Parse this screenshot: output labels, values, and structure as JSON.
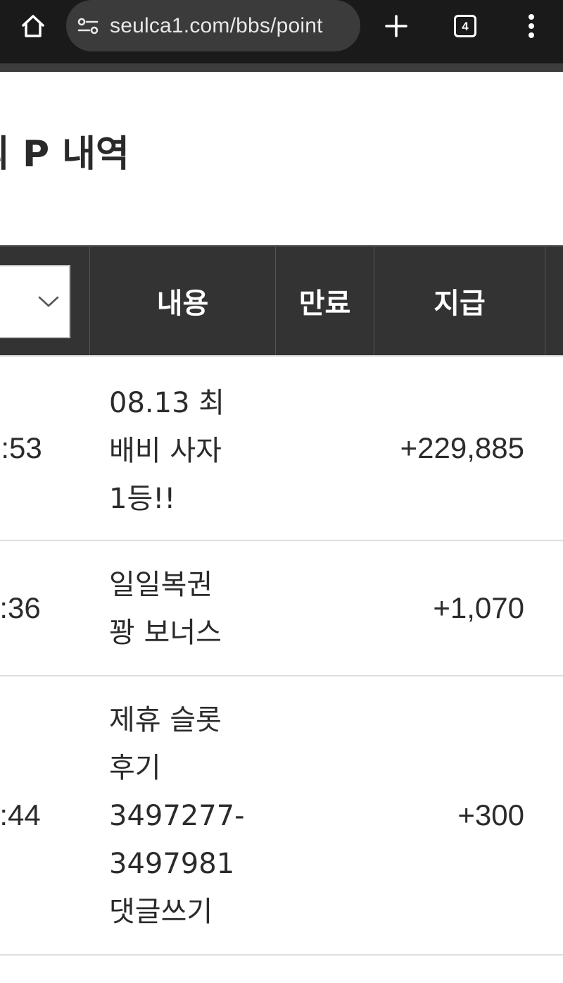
{
  "browser": {
    "url": "seulca1.com/bbs/point",
    "tab_count": "4",
    "icons": {
      "home": "home-icon",
      "site_info": "site-settings-icon",
      "new_tab": "plus-icon",
      "tabs": "tab-switcher-icon",
      "menu": "more-vert-icon"
    }
  },
  "page": {
    "title": "의 P 내역"
  },
  "table": {
    "columns": {
      "content": "내용",
      "expire": "만료",
      "pay": "지급"
    },
    "rows": [
      {
        "time": ":53",
        "content_lines": [
          "08.13 최",
          "배비 사자",
          "1등!!"
        ],
        "pay": "+229,885"
      },
      {
        "time": ":36",
        "content_lines": [
          "일일복권",
          "꽝 보너스"
        ],
        "pay": "+1,070"
      },
      {
        "time": ":44",
        "content_lines": [
          "제휴 슬롯",
          "후기",
          "3497277-",
          "3497981",
          "댓글쓰기"
        ],
        "pay": "+300"
      }
    ]
  },
  "colors": {
    "browser_bar": "#1a1a1a",
    "url_pill": "#3b3b3b",
    "table_header": "#333333",
    "text": "#2b2b2b"
  }
}
